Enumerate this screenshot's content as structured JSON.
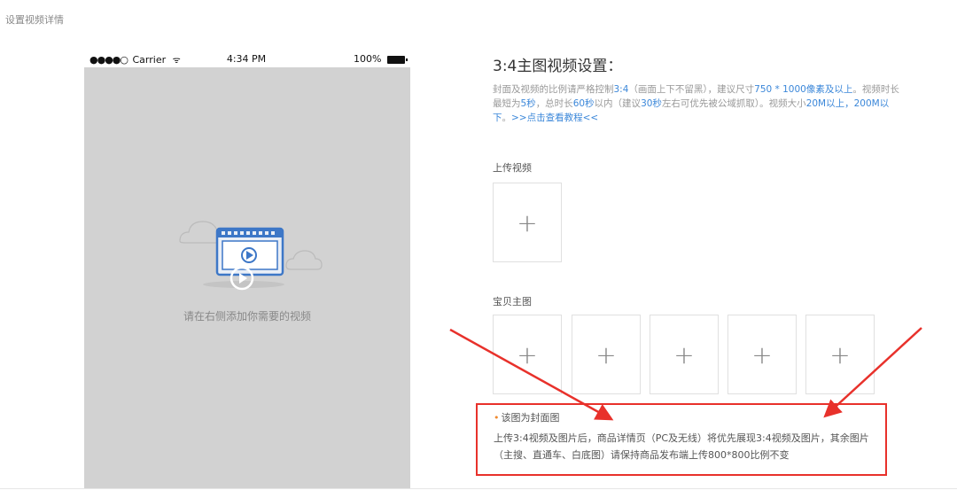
{
  "page": {
    "title": "设置视频详情"
  },
  "phone": {
    "status": {
      "signal": "●●●●○",
      "carrier": "Carrier",
      "time": "4:34 PM",
      "battery": "100%"
    },
    "empty_hint": "请在右侧添加你需要的视频"
  },
  "settings": {
    "title": "3:4主图视频设置：",
    "desc": {
      "p1": "封面及视频的比例请严格控制",
      "h1": "3:4",
      "p2": "（画面上下不留黑），建议尺寸",
      "h2": "750 * 1000像素及以上",
      "p3": "。视频时长最短为",
      "h3": "5秒",
      "p4": "，总时长",
      "h4": "60秒",
      "p5": "以内（建议",
      "h5": "30秒",
      "p6": "左右可优先被公域抓取）。视频大小",
      "h6": "20M以上，200M以下",
      "p7": "。",
      "link": ">>点击查看教程<<"
    },
    "upload_video_label": "上传视频",
    "main_image_label": "宝贝主图",
    "plus_symbol": "+",
    "cover_note": {
      "title": "该图为封面图",
      "text": "上传3:4视频及图片后，商品详情页（PC及无线）将优先展现3:4视频及图片，其余图片（主搜、直通车、白底图）请保持商品发布端上传800*800比例不变"
    }
  },
  "colors": {
    "accent": "#3b87d9",
    "annotation_red": "#e8312b",
    "dot_orange": "#f08a2e",
    "phone_bg": "#d2d2d2"
  }
}
